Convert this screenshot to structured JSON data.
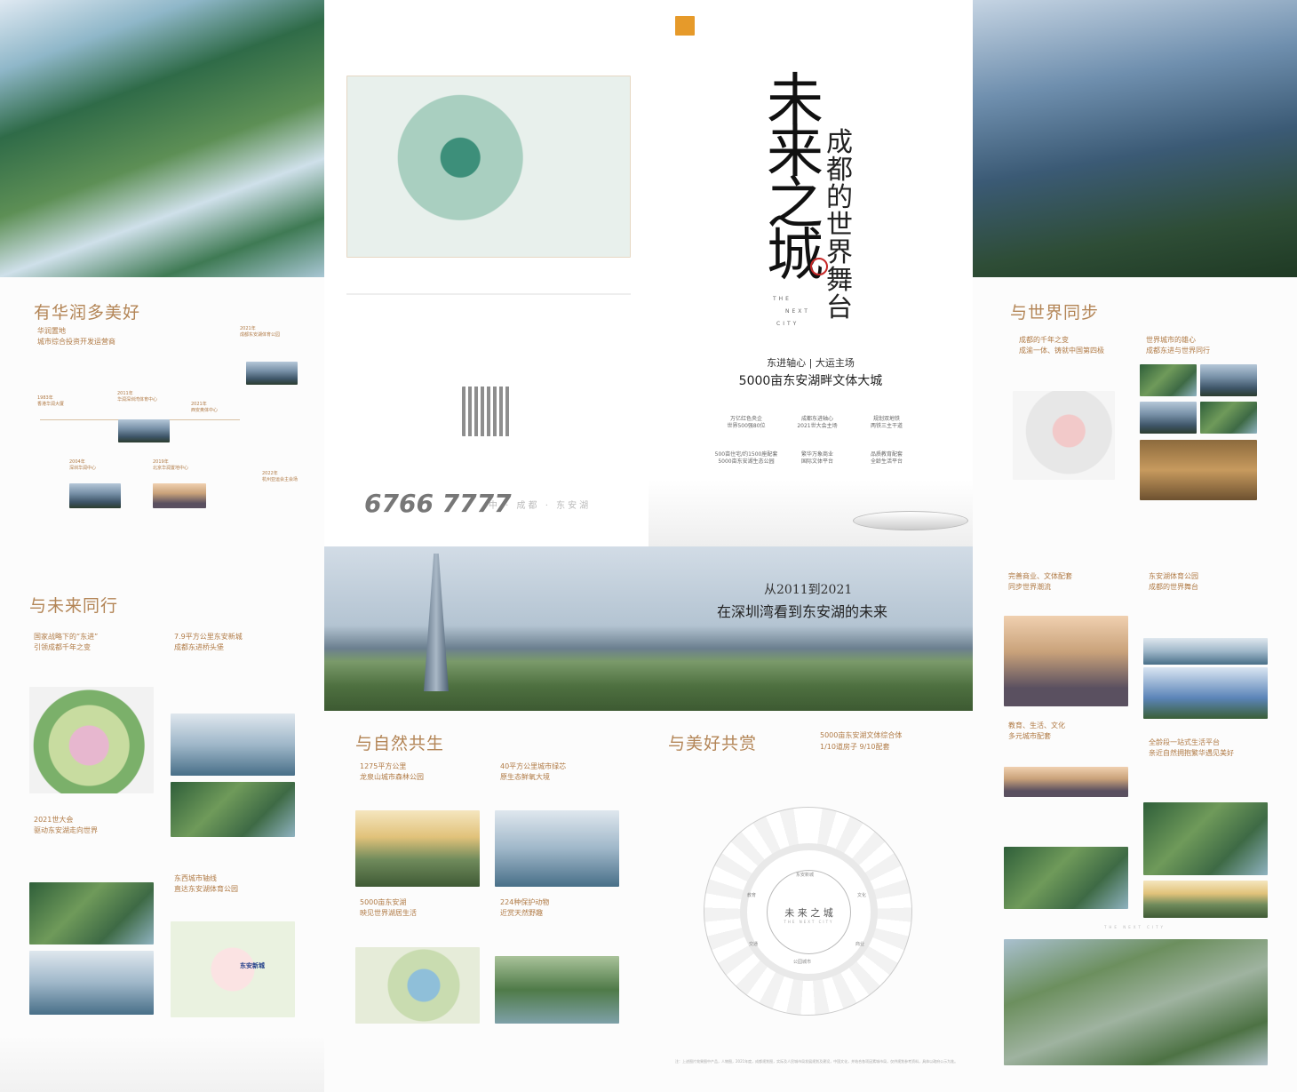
{
  "cover": {
    "title_big": [
      "未",
      "来",
      "之",
      "城"
    ],
    "title_small": [
      "成",
      "都",
      "的",
      "世",
      "界",
      "舞",
      "台"
    ],
    "en_tag": [
      "THE",
      "NEXT",
      "CITY"
    ],
    "tagline": "东进轴心 | 大运主场",
    "headline": "5000亩东安湖畔文体大城",
    "features": [
      "万亿红色央企\n世界500强80位",
      "成都东进轴心\n2021世大会主场",
      "规划双地铁\n两铁三主干道",
      "500亩住宅/约1500座配套\n5000亩东安湖生态公园",
      "繁华万象商业\n国际文体平台",
      "品质教育配套\n全龄生活平台"
    ]
  },
  "hotline": {
    "number": "6766 7777",
    "tag": "中 · 成都 · 东安湖"
  },
  "sections": {
    "heritage": {
      "title": "有华润多美好",
      "sub1": "华润置地",
      "sub1b": "城市综合投资开发运营商",
      "milestones": [
        {
          "year": "1983年",
          "name": "香港华润大厦"
        },
        {
          "year": "2011年",
          "name": "华润深圳湾体育中心"
        },
        {
          "year": "2021年",
          "name": "成都东安湖体育公园"
        },
        {
          "year": "2004年",
          "name": "深圳华润中心"
        },
        {
          "year": "2019年",
          "name": "北京华润置地中心"
        },
        {
          "year": "2021年",
          "name": "西安奥体中心"
        },
        {
          "year": "2022年",
          "name": "杭州亚运会主会场"
        }
      ]
    },
    "world": {
      "title": "与世界同步",
      "c1a": "成都的千年之变",
      "c1b": "成渝一体、铸就中国第四极",
      "c2a": "世界城市的雄心",
      "c2b": "成都东进与世界同行"
    },
    "future": {
      "title": "与未来同行",
      "c1a": "国家战略下的“东进”",
      "c1b": "引领成都千年之变",
      "c2a": "7.9平方公里东安新城",
      "c2b": "成都东进桥头堡",
      "c3a": "2021世大会",
      "c3b": "驱动东安湖走向世界",
      "c4a": "东西城市轴线",
      "c4b": "直达东安湖体育公园",
      "map_label": "东安新城"
    },
    "banner": {
      "line1": "从2011到2021",
      "line2": "在深圳湾看到东安湖的未来"
    },
    "nature": {
      "title": "与自然共生",
      "c1a": "1275平方公里",
      "c1b": "龙泉山城市森林公园",
      "c2a": "40平方公里城市绿芯",
      "c2b": "原生态鲜氧大境",
      "c3a": "5000亩东安湖",
      "c3b": "映见世界湖居生活",
      "c4a": "224种保护动物",
      "c4b": "近赏天然野趣"
    },
    "beauty": {
      "title": "与美好共赏",
      "c1a": "5000亩东安湖文体综合体",
      "c1b": "1/10道房子 9/10配套",
      "wheel_center": "未 来 之 城",
      "wheel_center_sub": "THE NEXT CITY",
      "ring": [
        "东安新城",
        "文化",
        "商业",
        "公园城市",
        "交通",
        "教育"
      ]
    },
    "commerce": {
      "c1a": "完善商业、文体配套",
      "c1b": "同步世界潮流",
      "c2a": "东安湖体育公园",
      "c2b": "成都的世界舞台",
      "c3a": "教育、生活、文化",
      "c3b": "多元城市配套",
      "c4a": "全龄段一站式生活平台",
      "c4b": "亲近自然拥抱繁华遇见美好"
    }
  },
  "brand_en": "THE NEXT CITY",
  "footer_note": "注：上述图片效果图中产品，人物图，2021年度，成都规划图，实际及人民城市局发展规划及建设，中国文化，并结合各项因素城市局，仅供规划参考资料，具体以政府公示为准。"
}
